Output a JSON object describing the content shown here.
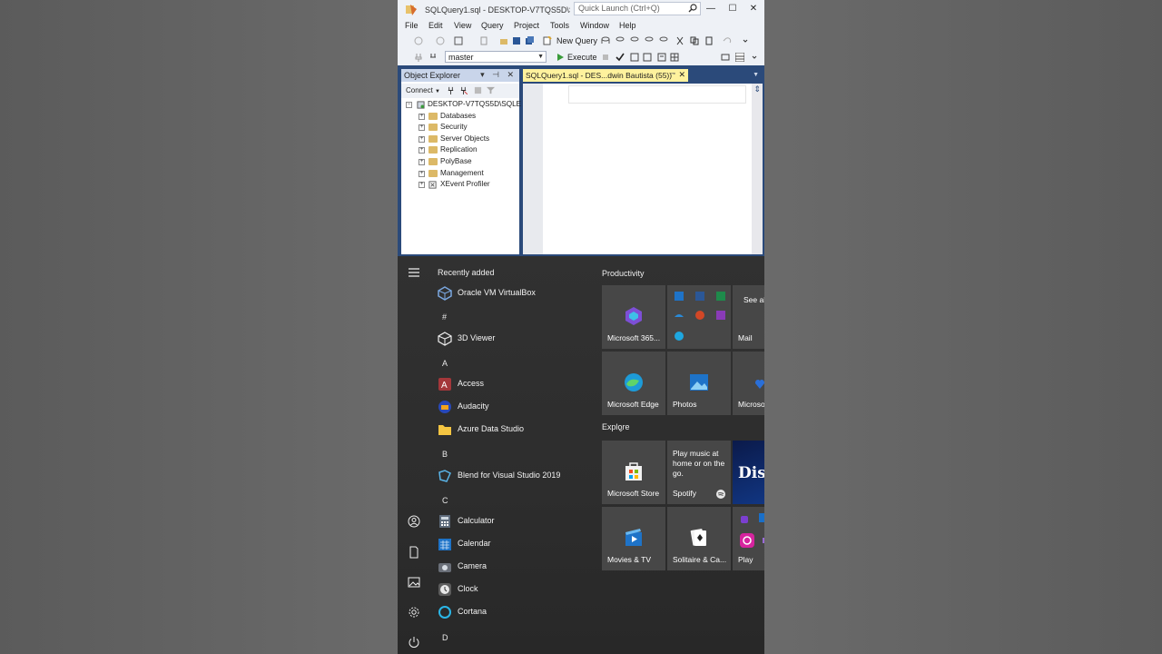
{
  "ssms": {
    "window_title": "SQLQuery1.sql - DESKTOP-V7TQS5D\\SQLE...",
    "quick_launch_placeholder": "Quick Launch (Ctrl+Q)",
    "menu": [
      "File",
      "Edit",
      "View",
      "Query",
      "Project",
      "Tools",
      "Window",
      "Help"
    ],
    "toolbar": {
      "new_query": "New Query",
      "database": "master",
      "execute": "Execute"
    },
    "object_explorer": {
      "title": "Object Explorer",
      "connect": "Connect",
      "server": "DESKTOP-V7TQS5D\\SQLE",
      "nodes": [
        "Databases",
        "Security",
        "Server Objects",
        "Replication",
        "PolyBase",
        "Management",
        "XEvent Profiler"
      ]
    },
    "tab": {
      "label": "SQLQuery1.sql - DES...dwin Bautista (55))"
    },
    "colors": {
      "chrome": "#eef1f6",
      "dock": "#2b4a7a",
      "active_tab": "#fff29d"
    }
  },
  "start_menu": {
    "recently_added": "Recently added",
    "productivity": "Productivity",
    "explore": "Explore",
    "apps": [
      {
        "label": "Oracle VM VirtualBox",
        "icon": "virtualbox-icon"
      },
      {
        "label": "3D Viewer",
        "icon": "cube-icon"
      },
      {
        "label": "Access",
        "icon": "access-icon"
      },
      {
        "label": "Audacity",
        "icon": "audacity-icon"
      },
      {
        "label": "Azure Data Studio",
        "icon": "folder-icon"
      },
      {
        "label": "Blend for Visual Studio 2019",
        "icon": "blend-icon"
      },
      {
        "label": "Calculator",
        "icon": "calculator-icon"
      },
      {
        "label": "Calendar",
        "icon": "calendar-icon"
      },
      {
        "label": "Camera",
        "icon": "camera-icon"
      },
      {
        "label": "Clock",
        "icon": "clock-icon"
      },
      {
        "label": "Cortana",
        "icon": "cortana-icon"
      }
    ],
    "letters": [
      "#",
      "A",
      "B",
      "C",
      "D"
    ],
    "tiles": {
      "m365": "Microsoft 365...",
      "mail_text": "See al mail i pla",
      "mail": "Mail",
      "edge": "Microsoft Edge",
      "photos": "Photos",
      "microsoft_partial": "Microso",
      "store": "Microsoft Store",
      "spotify_text": "Play music at home or on the go.",
      "spotify": "Spotify",
      "disney": "Dis",
      "movies": "Movies & TV",
      "solitaire": "Solitaire & Ca...",
      "play": "Play"
    }
  }
}
